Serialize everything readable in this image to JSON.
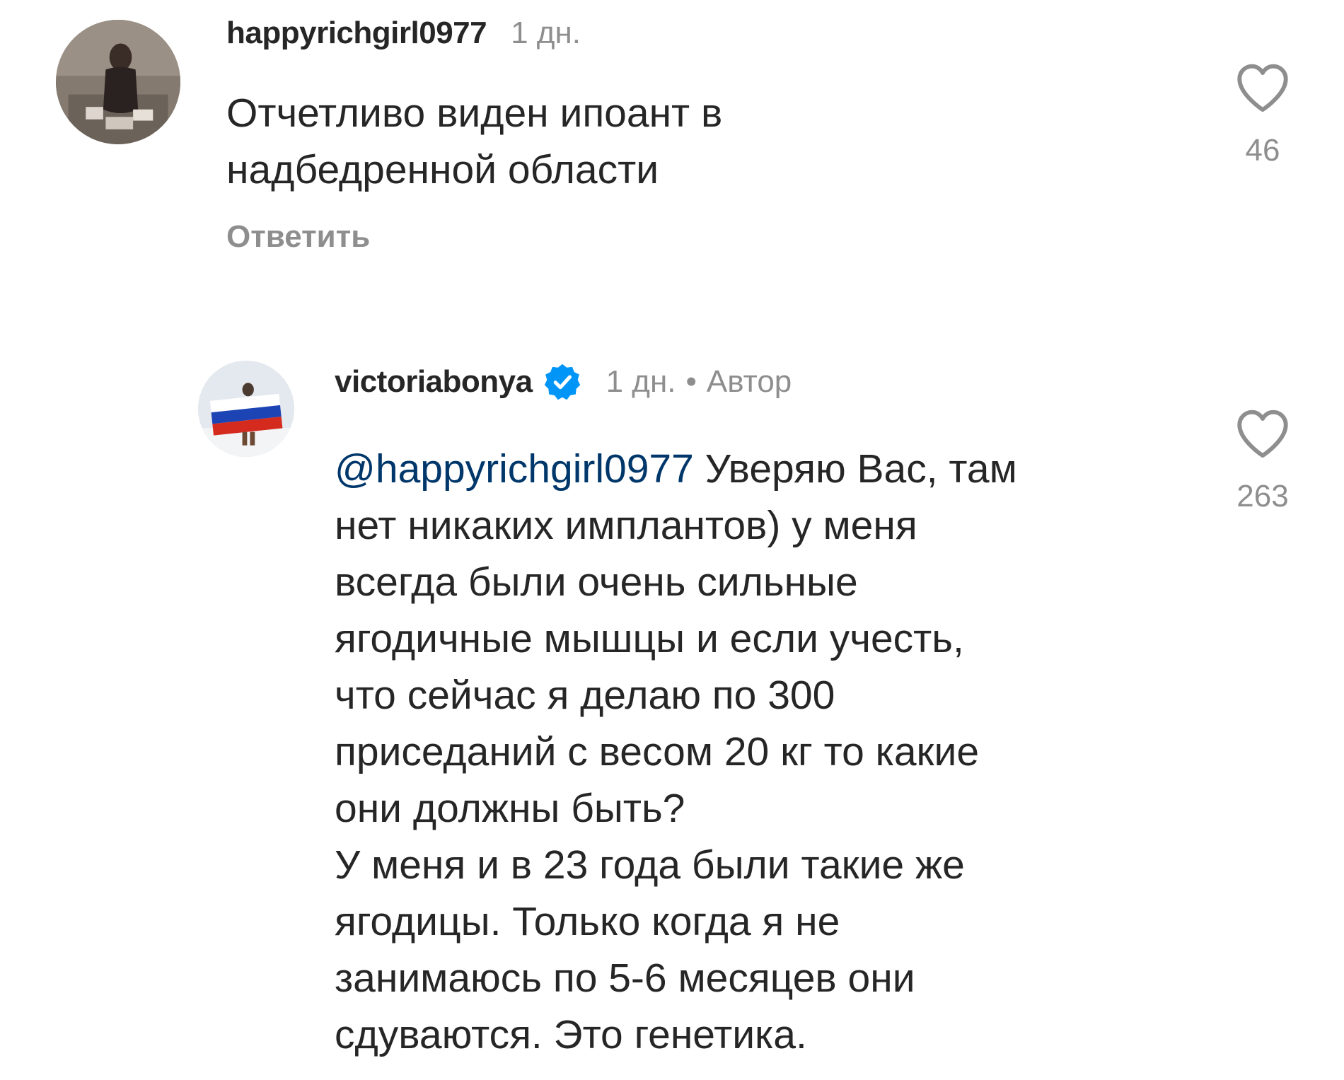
{
  "comments": [
    {
      "username": "happyrichgirl0977",
      "time": "1 дн.",
      "text": "Отчетливо виден ипоант в\nнадбедренной области",
      "reply_label": "Ответить",
      "likes": "46"
    },
    {
      "username": "victoriabonya",
      "verified": true,
      "time": "1 дн.",
      "dot": "•",
      "author_label": "Автор",
      "mention": "@happyrichgirl0977",
      "text": " Уверяю Вас, там\nнет никаких имплантов) у меня\nвсегда были очень сильные\nягодичные мышцы и если учесть,\nчто сейчас я делаю по 300\nприседаний с весом 20 кг то какие\nони должны быть?\nУ меня и в 23 года были такие же\nягодицы. Только когда я не\nзанимаюсь по 5-6 месяцев они\nсдуваются. Это генетика.",
      "likes": "263"
    }
  ],
  "colors": {
    "text": "#262626",
    "muted": "#8e8e8e",
    "mention": "#00376b",
    "verified": "#0095f6"
  },
  "icons": {
    "like": "heart-outline-icon",
    "verified": "verified-badge-icon"
  }
}
